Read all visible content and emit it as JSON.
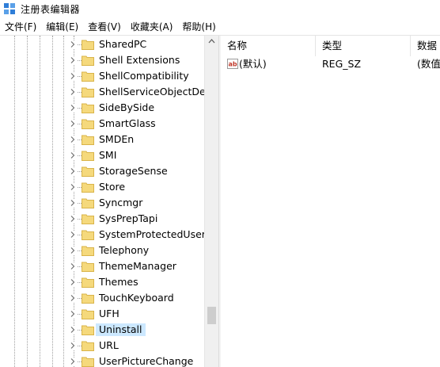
{
  "window": {
    "title": "注册表编辑器",
    "icon": "registry-editor-icon"
  },
  "menu": [
    {
      "label": "文件(F)"
    },
    {
      "label": "编辑(E)"
    },
    {
      "label": "查看(V)"
    },
    {
      "label": "收藏夹(A)"
    },
    {
      "label": "帮助(H)"
    }
  ],
  "tree": {
    "selected": "Uninstall",
    "folder_color": "#f5d97c",
    "items": [
      {
        "label": "SharedPC"
      },
      {
        "label": "Shell Extensions"
      },
      {
        "label": "ShellCompatibility"
      },
      {
        "label": "ShellServiceObjectDela"
      },
      {
        "label": "SideBySide"
      },
      {
        "label": "SmartGlass"
      },
      {
        "label": "SMDEn"
      },
      {
        "label": "SMI"
      },
      {
        "label": "StorageSense"
      },
      {
        "label": "Store"
      },
      {
        "label": "Syncmgr"
      },
      {
        "label": "SysPrepTapi"
      },
      {
        "label": "SystemProtectedUserD"
      },
      {
        "label": "Telephony"
      },
      {
        "label": "ThemeManager"
      },
      {
        "label": "Themes"
      },
      {
        "label": "TouchKeyboard"
      },
      {
        "label": "UFH"
      },
      {
        "label": "Uninstall"
      },
      {
        "label": "URL"
      },
      {
        "label": "UserPictureChange"
      }
    ]
  },
  "values": {
    "headers": {
      "name": "名称",
      "type": "类型",
      "data": "数据"
    },
    "rows": [
      {
        "icon": "string-value-ab-icon",
        "name": "(默认)",
        "type": "REG_SZ",
        "data": "(数值"
      }
    ]
  },
  "colors": {
    "selection": "#cce8ff",
    "scrollbar_thumb": "#cdcdcd"
  }
}
